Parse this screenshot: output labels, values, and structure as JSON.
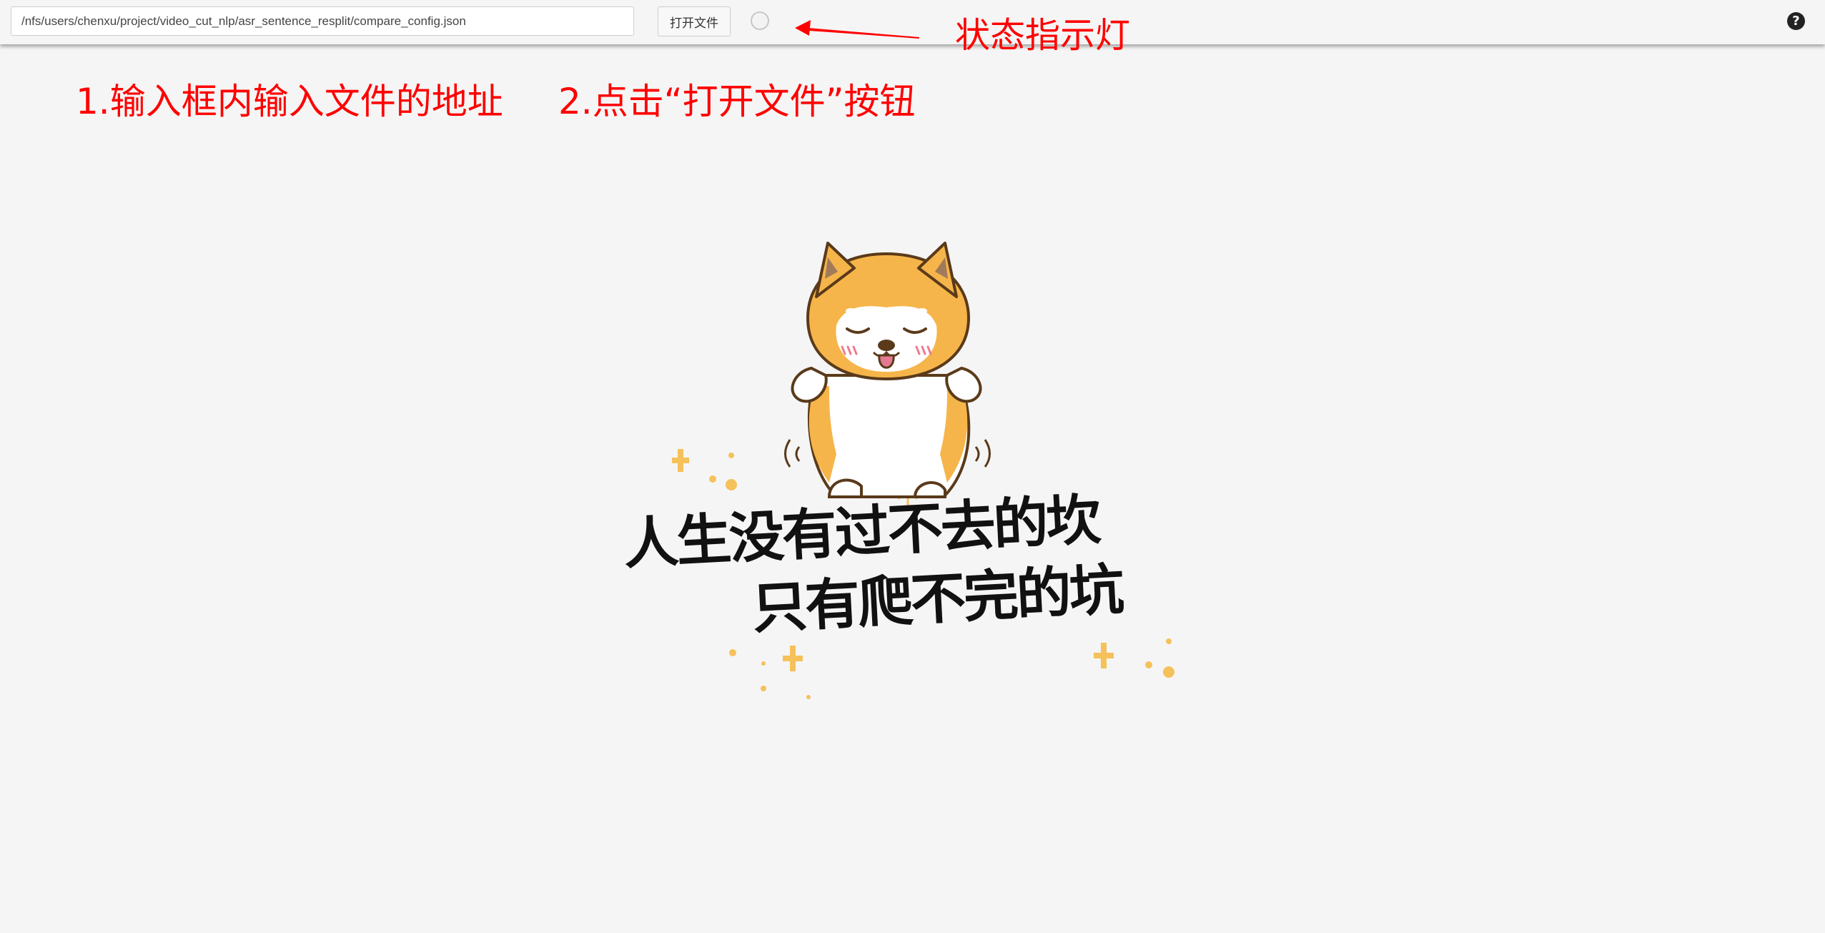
{
  "toolbar": {
    "path_value": "/nfs/users/chenxu/project/video_cut_nlp/asr_sentence_resplit/compare_config.json",
    "open_button_label": "打开文件",
    "status_state": "idle",
    "help_icon": "question-circle-icon"
  },
  "annotations": {
    "status_light_label": "状态指示灯",
    "step1": "1.输入框内输入文件的地址",
    "step2": "2.点击“打开文件”按钮",
    "color": "#ff0000"
  },
  "empty_state": {
    "slogan_line1": "人生没有过不去的坎",
    "slogan_line2": "只有爬不完的坑"
  },
  "colors": {
    "background": "#f5f5f5",
    "annotation_red": "#ff0000",
    "dog_orange": "#f6b54a",
    "sparkle_yellow": "#f5c15a"
  }
}
